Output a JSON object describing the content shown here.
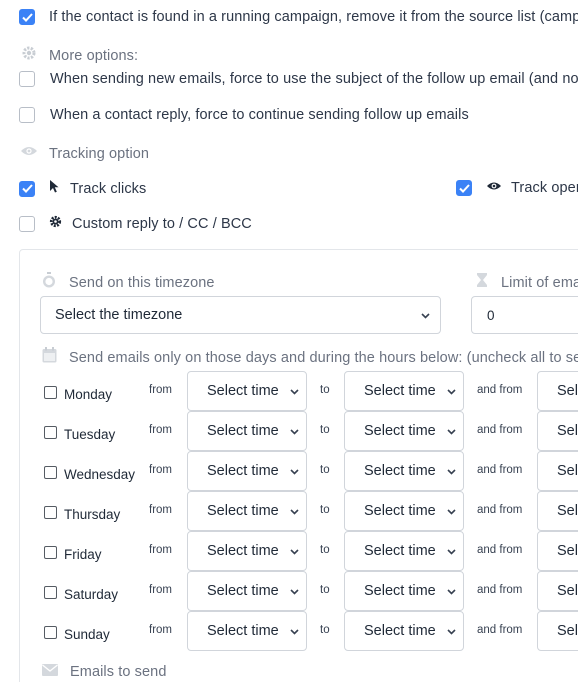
{
  "options": {
    "campaign_remove_label": "If the contact is found in a running campaign, remove it from the source list (camp",
    "campaign_remove_checked": true,
    "more_options_label": "More options:",
    "force_subject_label": "When sending new emails, force to use the subject of the follow up email (and not",
    "force_continue_label": "When a contact reply, force to continue sending follow up emails",
    "tracking_label": "Tracking option",
    "track_clicks_label": "Track clicks",
    "track_opens_label": "Track oper",
    "custom_reply_label": "Custom reply to / CC / BCC"
  },
  "panel": {
    "timezone_label": "Send on this timezone",
    "timezone_value": "Select the timezone",
    "limit_label": "Limit of ema",
    "limit_value": "0",
    "days_hint": "Send emails only on those days and during the hours below: (uncheck all to sen",
    "from_label": "from",
    "to_label": "to",
    "and_from_label": "and from",
    "time_placeholder": "Select time",
    "time_placeholder_cut": "Sel",
    "emails_to_send_label": "Emails to send",
    "days": [
      "Monday",
      "Tuesday",
      "Wednesday",
      "Thursday",
      "Friday",
      "Saturday",
      "Sunday"
    ]
  },
  "colors": {
    "checkbox_accent": "#3b82f6",
    "muted_text": "#6b7280",
    "border": "#d1d5db"
  },
  "icons": [
    "gear-icon",
    "eye-icon",
    "cursor-icon",
    "cog-icon",
    "stopwatch-icon",
    "hourglass-icon",
    "calendar-icon",
    "envelope-icon",
    "chevron-down-icon"
  ]
}
